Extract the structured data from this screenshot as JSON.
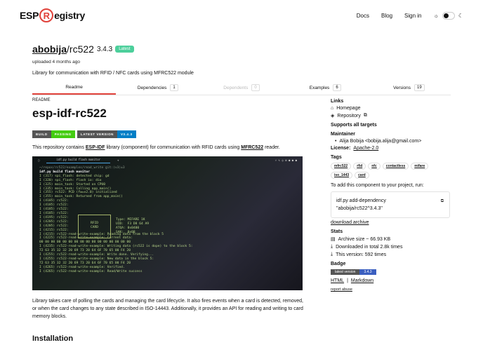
{
  "header": {
    "logo_left": "ESP",
    "logo_r": "R",
    "logo_right": "egistry",
    "nav": [
      "Docs",
      "Blog",
      "Sign in"
    ]
  },
  "package": {
    "owner": "abobija",
    "name": "rc522",
    "version": "3.4.3",
    "latest": "Latest",
    "uploaded": "uploaded 4 months ago",
    "description": "Library for communication with RFID / NFC cards using MFRC522 module"
  },
  "tabs": [
    {
      "label": "Readme"
    },
    {
      "label": "Dependencies",
      "count": "1"
    },
    {
      "label": "Dependents",
      "count": "0"
    },
    {
      "label": "Examples",
      "count": "6"
    },
    {
      "label": "Versions",
      "count": "19"
    }
  ],
  "readme": {
    "section": "README",
    "title": "esp-idf-rc522",
    "badges": {
      "build": "BUILD",
      "passing": "PASSING",
      "latest": "LATEST VERSION",
      "version": "V3.4.3"
    },
    "intro_a": "This repository contains ",
    "intro_link1": "ESP-IDF",
    "intro_b": " library (component) for communication with RFID cards using ",
    "intro_link2": "MFRC522",
    "intro_c": " reader.",
    "terminal": {
      "tab": "idf.py build flash monitor",
      "lines": [
        "~/repos/rc522/examples/read_write git:(v3)±3",
        "idf.py build flash monitor",
        "I (317) spi_flash: detected chip: gd",
        "I (320) spi_flash: flash io: dio",
        "I (325) main_task: Started on CPU0",
        "I (335) main_task: Calling app_main()",
        "I (355) rc522: PCD (fw=v2.0) initialized",
        "I (355) main_task: Returned from app_main()",
        "I (4185) rc522:",
        "I (4185) rc522:",
        "I (4185) rc522:",
        "I (4185) rc522:",
        "I (4195) rc522:",
        "I (4205) rc522:",
        "I (4205) rc522:",
        "I (4215) rc522:",
        "I (4215) rc522-read-write-example: Reading data from the block 5",
        "I (4225) rc522-read-write-example: Current data:",
        "00 00 00 00 00 00 00 00 00 00 00 00 00 00 00 00",
        "I (4235) rc522-read-write-example: Writing data (rc522 is dope) to the block 5:",
        "72 63 35 32 32 20 69 73 20 64 6F 70 65 00 F4 20",
        "I (4255) rc522-read-write-example: Write done. Verifying...",
        "I (4255) rc522-read-write-example: New data in the block 5:",
        "72 63 35 32 32 20 69 73 20 64 6F 70 65 00 F4 20",
        "I (4265) rc522-read-write-example: Verified.",
        "I (4265) rc522-read-write-example: Read/Write success"
      ],
      "card": "RFID\nCARD",
      "card_info": "Type: MIFARE 1K\nUID:  F3 D8 64 A9\nATQA: 0x0400\nSAK:  0x08"
    },
    "para": "Library takes care of polling the cards and managing the card lifecycle. It also fires events when a card is detected, removed, or when the card changes to any state described in ISO-14443. Additionally, it provides an API for reading and writing to card memory blocks.",
    "installation": "Installation"
  },
  "sidebar": {
    "links_title": "Links",
    "homepage": "Homepage",
    "repository": "Repository",
    "targets": "Supports all targets",
    "maintainer_title": "Maintainer",
    "maintainer": "Alija Bobija <bobija.alija@gmail.com>",
    "license_label": "License:",
    "license": "Apache-2.0",
    "tags_title": "Tags",
    "tags": [
      "mfrc522",
      "rfid",
      "nfc",
      "contactless",
      "mifare",
      "iso_1443",
      "card"
    ],
    "add_text": "To add this component to your project, run:",
    "cmd1": "idf.py add-dependency",
    "cmd2": "\"abobija/rc522^3.4.3\"",
    "download": "download archive",
    "stats_title": "Stats",
    "archive": "Archive size ~ 66.93 KB",
    "downloaded": "Downloaded in total 2.8k times",
    "this_version": "This version: 592 times",
    "badge_title": "Badge",
    "badge_left": "latest version",
    "badge_right": "3.4.3",
    "html": "HTML",
    "sep": "|",
    "markdown": "Markdown",
    "report": "report abuse"
  }
}
